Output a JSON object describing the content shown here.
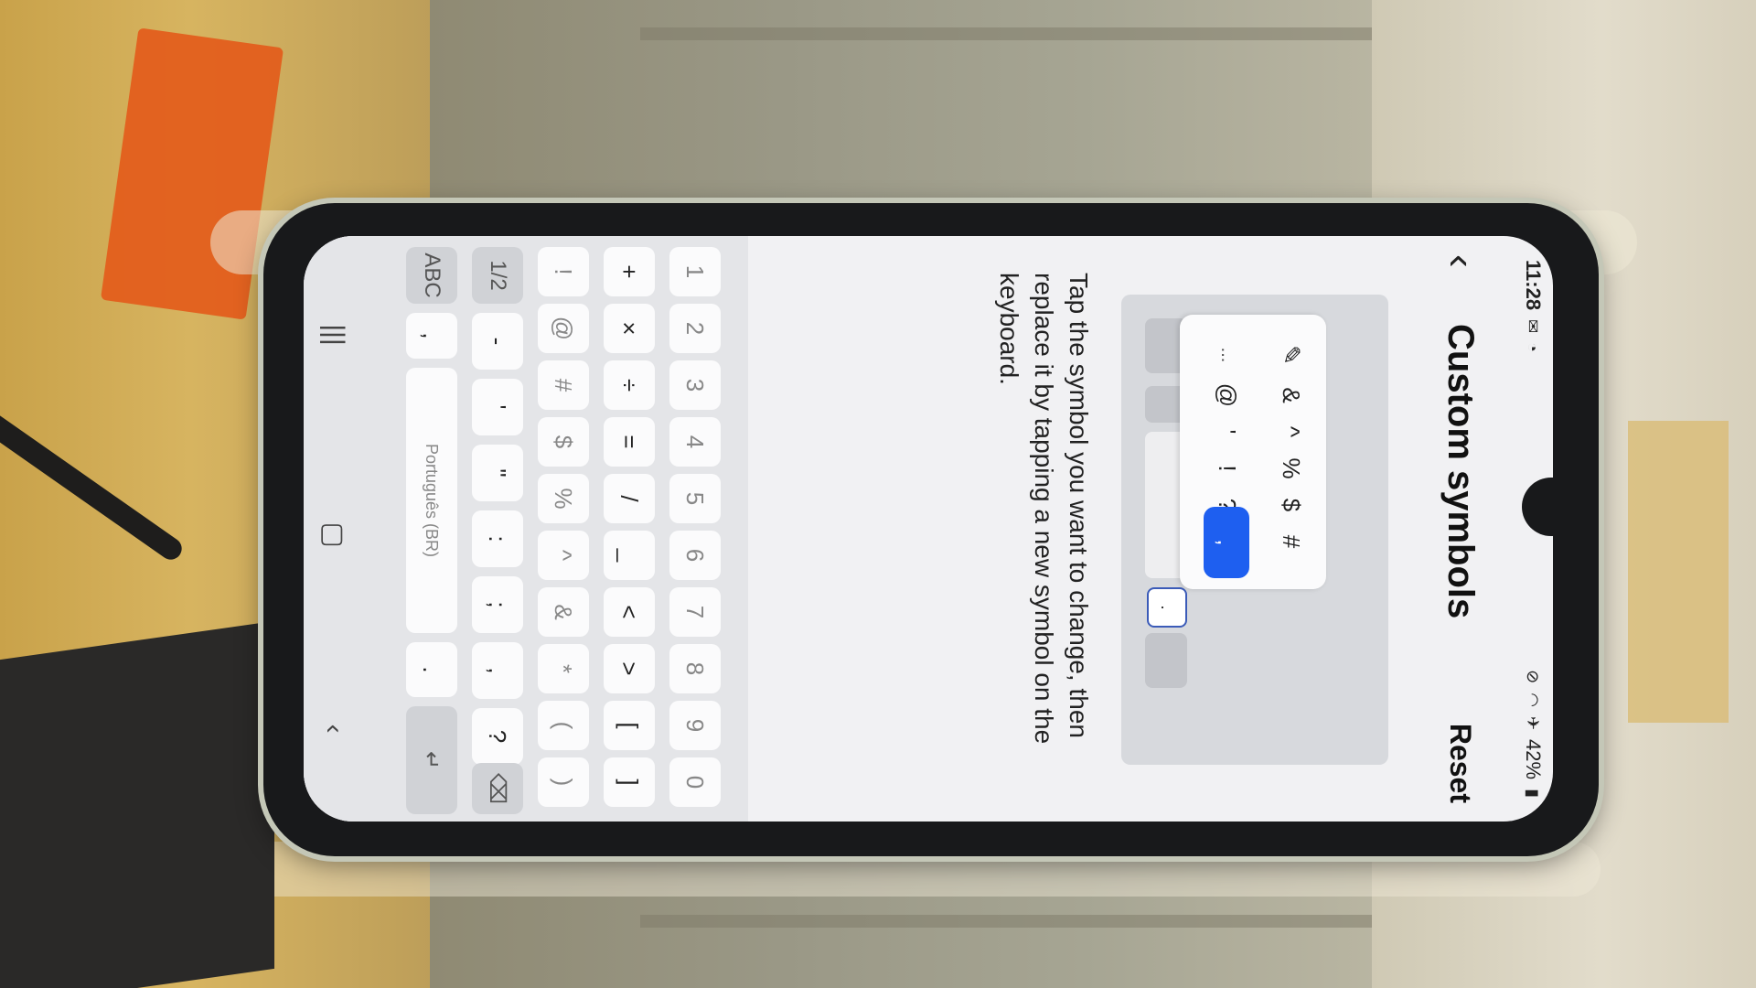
{
  "status": {
    "time": "11:28",
    "battery": "42%"
  },
  "appbar": {
    "title": "Custom symbols",
    "reset_label": "Reset",
    "back_icon": "chevron-left-icon"
  },
  "preview": {
    "popup_symbols": [
      "&",
      "^",
      "%",
      "$",
      "#",
      "@",
      "'",
      "!",
      "?",
      ","
    ],
    "more_label": "...",
    "selected_symbol": ",",
    "focused_key": "."
  },
  "description": "Tap the symbol you want to change, then replace it by tapping a new symbol on the keyboard.",
  "keyboard": {
    "row_numbers": [
      "1",
      "2",
      "3",
      "4",
      "5",
      "6",
      "7",
      "8",
      "9",
      "0"
    ],
    "row_2": [
      "+",
      "×",
      "÷",
      "=",
      "/",
      "_",
      "<",
      ">",
      "[",
      "]"
    ],
    "row_3": [
      "!",
      "@",
      "#",
      "$",
      "%",
      "^",
      "&",
      "*",
      "(",
      ")"
    ],
    "row_4_left": "1/2",
    "row_4": [
      "-",
      "'",
      "\"",
      ":",
      ";",
      ",",
      "?"
    ],
    "row_5_left": "ABC",
    "row_5_comma": ",",
    "space_label": "Português (BR)",
    "row_5_dot": "."
  },
  "navbar": {
    "recent": "|||",
    "home": "▢",
    "back": "‹"
  }
}
